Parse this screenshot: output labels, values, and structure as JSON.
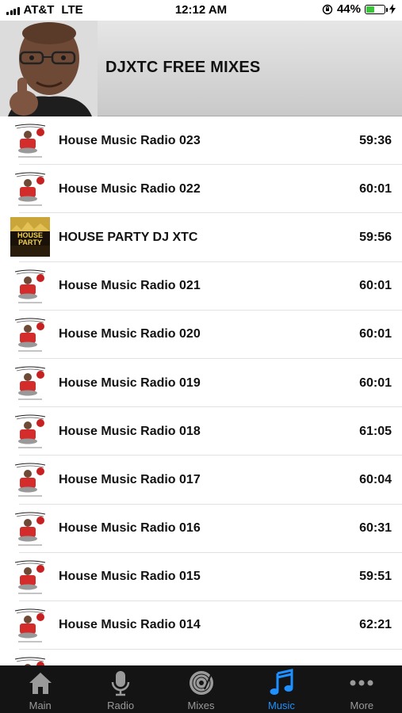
{
  "status_bar": {
    "carrier": "AT&T",
    "network": "LTE",
    "time": "12:12 AM",
    "battery": "44%",
    "battery_level": 0.44
  },
  "header": {
    "title": "DJXTC FREE MIXES"
  },
  "tracks": [
    {
      "title": "House Music Radio 023",
      "duration": "59:36",
      "thumb": "house-music-radio-logo"
    },
    {
      "title": "House Music Radio 022",
      "duration": "60:01",
      "thumb": "house-music-radio-logo"
    },
    {
      "title": "HOUSE PARTY DJ XTC",
      "duration": "59:56",
      "thumb": "house-party-cover",
      "thumb_text": "HOUSE PARTY"
    },
    {
      "title": "House Music Radio 021",
      "duration": "60:01",
      "thumb": "house-music-radio-logo"
    },
    {
      "title": "House Music Radio 020",
      "duration": "60:01",
      "thumb": "house-music-radio-logo"
    },
    {
      "title": "House Music Radio 019",
      "duration": "60:01",
      "thumb": "house-music-radio-logo"
    },
    {
      "title": "House Music Radio 018",
      "duration": "61:05",
      "thumb": "house-music-radio-logo"
    },
    {
      "title": "House Music Radio 017",
      "duration": "60:04",
      "thumb": "house-music-radio-logo"
    },
    {
      "title": "House Music Radio 016",
      "duration": "60:31",
      "thumb": "house-music-radio-logo"
    },
    {
      "title": "House Music Radio 015",
      "duration": "59:51",
      "thumb": "house-music-radio-logo"
    },
    {
      "title": "House Music Radio 014",
      "duration": "62:21",
      "thumb": "house-music-radio-logo"
    }
  ],
  "tab_bar": {
    "tabs": [
      {
        "label": "Main",
        "icon": "home-icon",
        "active": false
      },
      {
        "label": "Radio",
        "icon": "microphone-icon",
        "active": false
      },
      {
        "label": "Mixes",
        "icon": "vinyl-record-icon",
        "active": false
      },
      {
        "label": "Music",
        "icon": "music-note-icon",
        "active": true
      },
      {
        "label": "More",
        "icon": "more-dots-icon",
        "active": false
      }
    ]
  },
  "colors": {
    "accent": "#1e90ff",
    "tab_bar_bg": "#141414",
    "header_bg": "#d6d6d6",
    "battery": "#3cc43c"
  }
}
